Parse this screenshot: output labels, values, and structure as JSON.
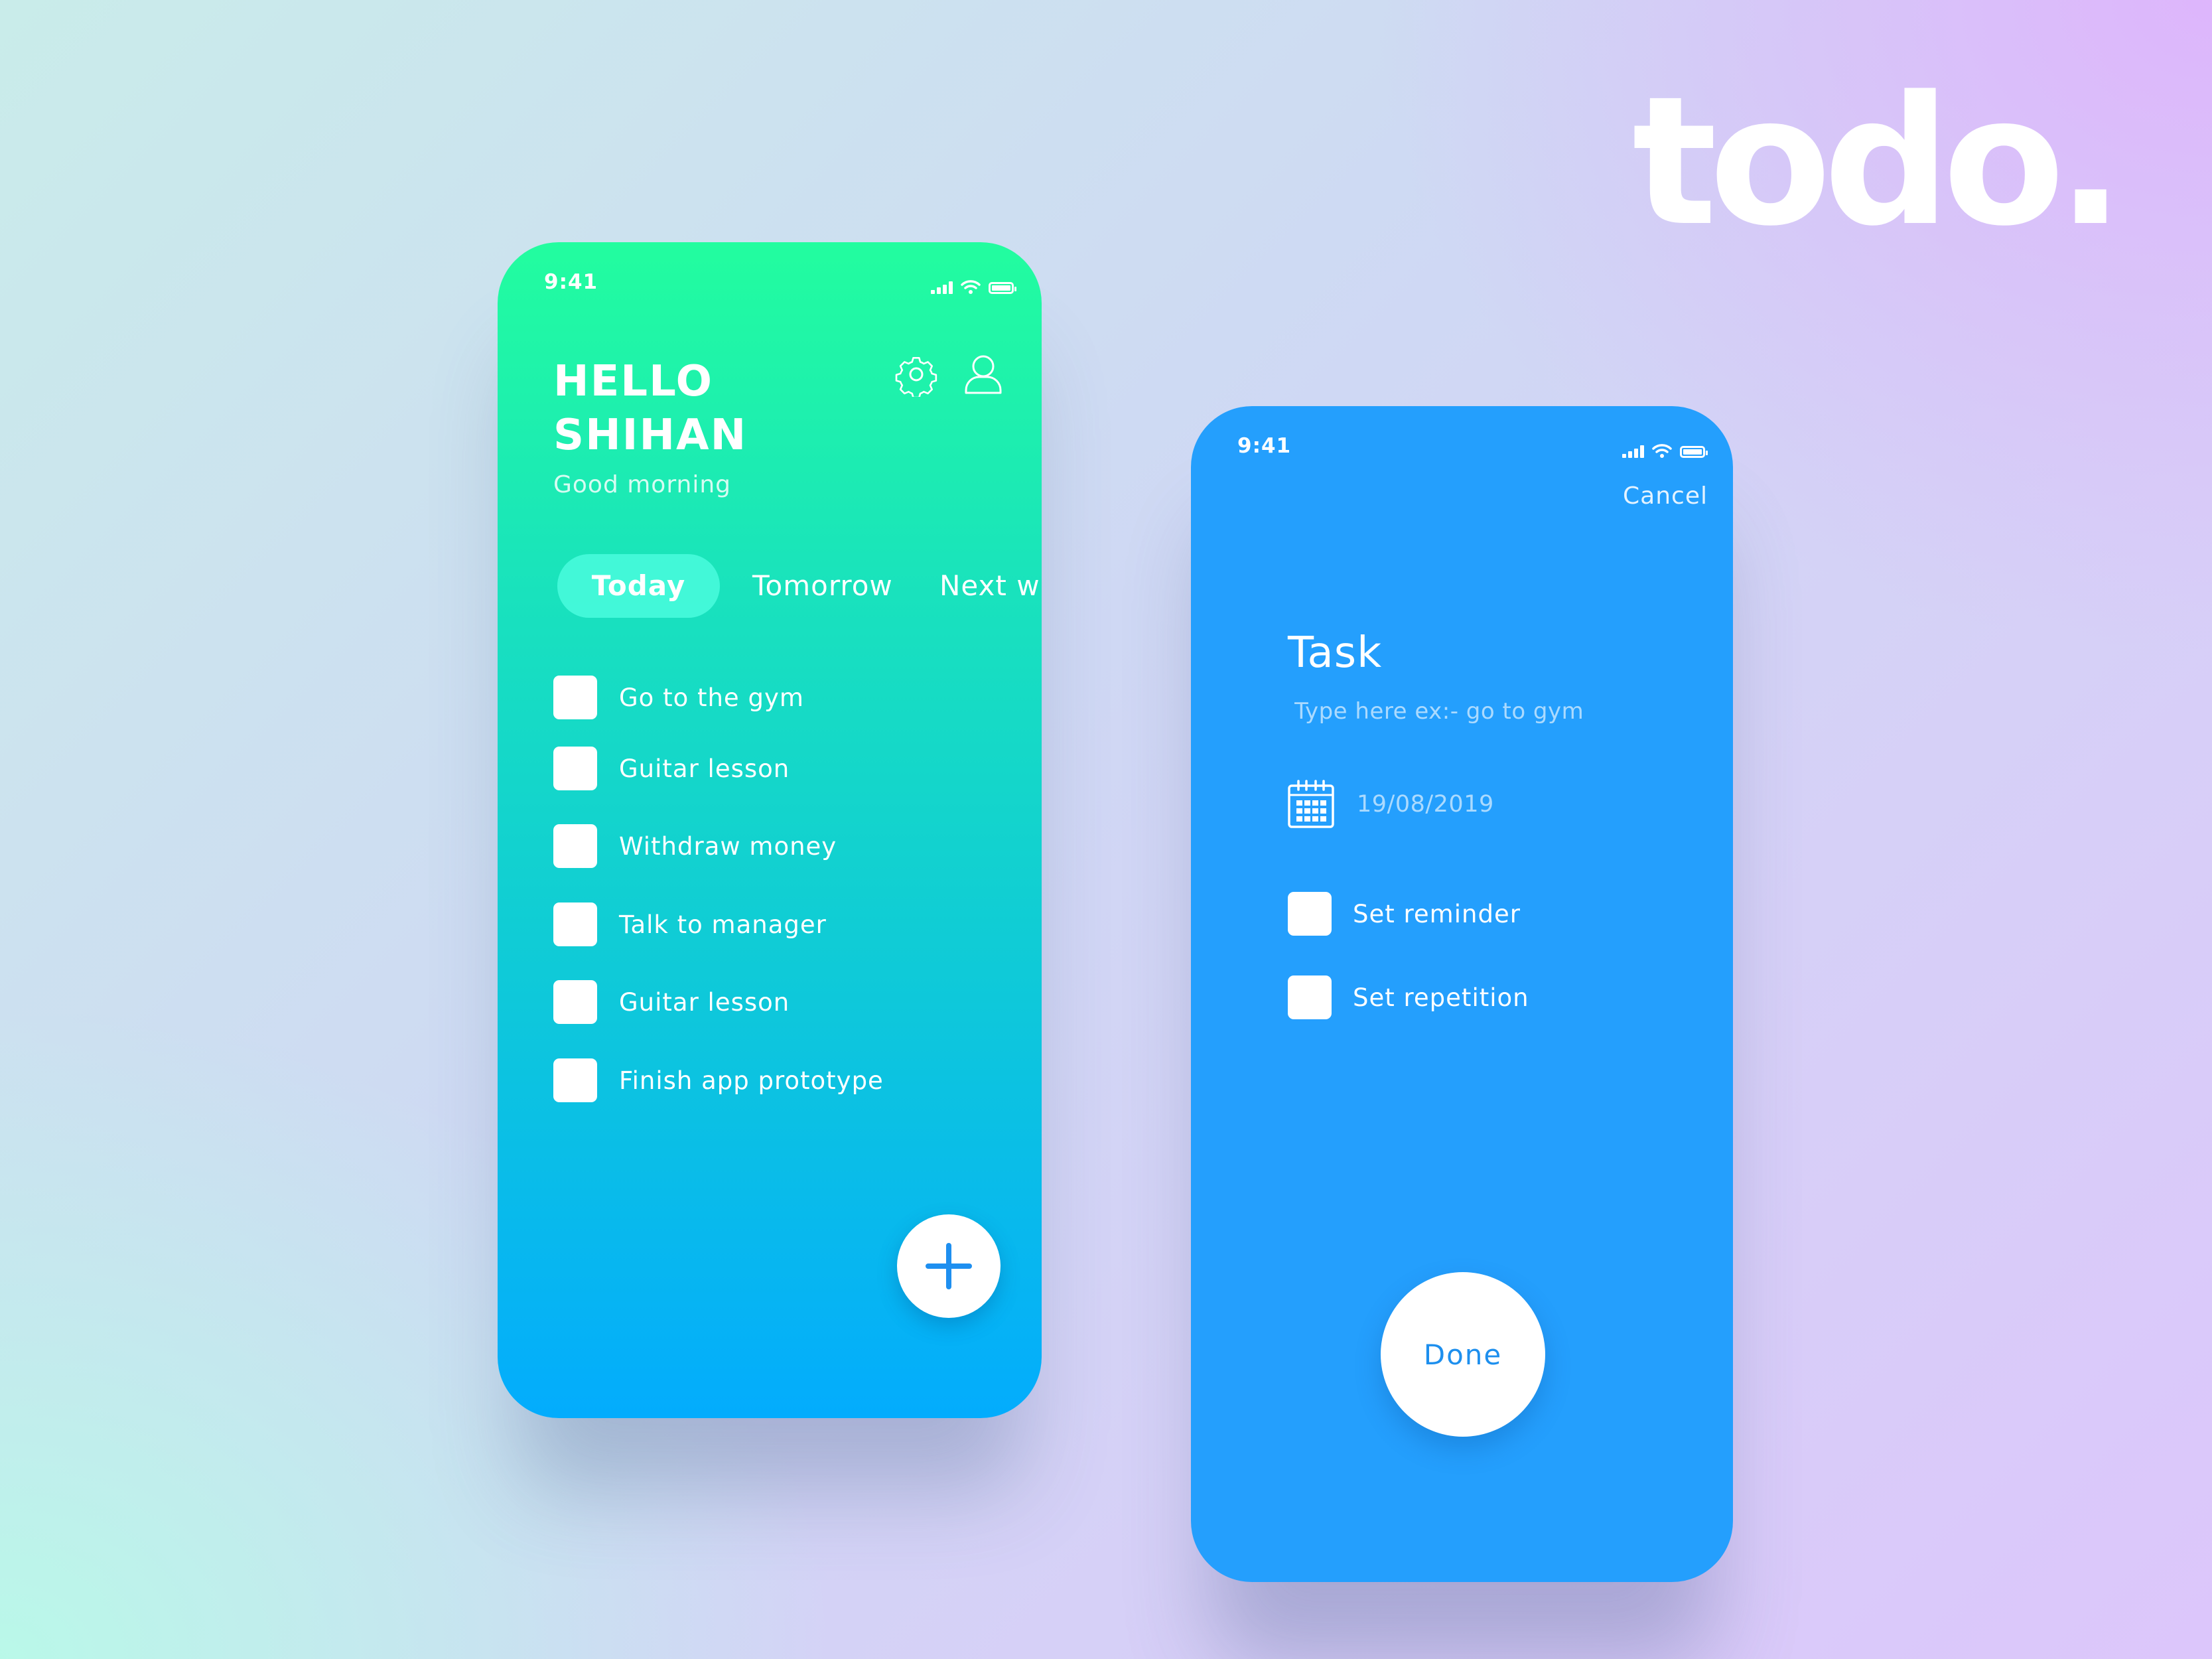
{
  "brand": {
    "logo": "todo."
  },
  "list_screen": {
    "status": {
      "time": "9:41"
    },
    "greeting_line1": "HELLO",
    "greeting_line2": "SHIHAN",
    "subtitle": "Good morning",
    "header_icons": [
      "gear-icon",
      "user-icon"
    ],
    "tabs": [
      {
        "label": "Today",
        "active": true
      },
      {
        "label": "Tomorrow",
        "active": false
      },
      {
        "label": "Next w",
        "active": false
      }
    ],
    "tasks": [
      {
        "label": "Go to the gym",
        "checked": false
      },
      {
        "label": "Guitar lesson",
        "checked": false
      },
      {
        "label": "Withdraw money",
        "checked": false
      },
      {
        "label": "Talk to manager",
        "checked": false
      },
      {
        "label": "Guitar lesson",
        "checked": false
      },
      {
        "label": "Finish app prototype",
        "checked": false
      }
    ],
    "fab_icon": "plus-icon",
    "colors": {
      "gradient_top": "#22fd9f",
      "gradient_bottom": "#03acfd",
      "plus": "#1e8ff0"
    }
  },
  "task_screen": {
    "status": {
      "time": "9:41"
    },
    "cancel_label": "Cancel",
    "title": "Task",
    "input_placeholder": "Type here ex:- go to gym",
    "date_icon": "calendar-icon",
    "date": "19/08/2019",
    "options": [
      {
        "label": "Set reminder",
        "checked": false
      },
      {
        "label": "Set repetition",
        "checked": false
      }
    ],
    "done_label": "Done",
    "colors": {
      "background": "#249ffd",
      "done_text": "#1d8fee"
    }
  }
}
